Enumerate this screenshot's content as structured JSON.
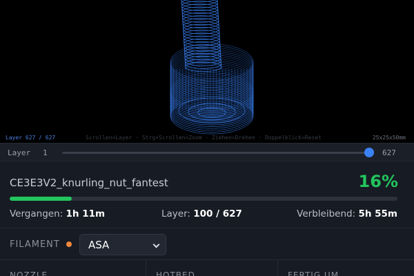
{
  "viewer": {
    "layer_readout": "Layer 627 / 627",
    "controls_hint": "Scrollen=Layer · Strg+Scrollen=Zoom · Ziehen=Drehen · Doppelklick=Reset",
    "dimensions": "25x25x50mm",
    "model_color": "#3b82f6"
  },
  "slider": {
    "label": "Layer",
    "min": "1",
    "max": "627",
    "value": 627,
    "accent": "#3b82f6"
  },
  "job": {
    "filename": "CE3E3V2_knurling_nut_fantest",
    "percent_label": "16%",
    "progress": 0.16,
    "accent": "#22c55e",
    "elapsed_label": "Vergangen:",
    "elapsed_value": "1h 11m",
    "layer_label": "Layer:",
    "layer_value": "100 / 627",
    "remaining_label": "Verbleibend:",
    "remaining_value": "5h 55m"
  },
  "filament": {
    "label": "FILAMENT",
    "dot_color": "#f0883e",
    "selected": "ASA",
    "icon": "chevron-down-icon"
  },
  "cards": [
    {
      "title": "NOZZLE"
    },
    {
      "title": "HOTBED"
    },
    {
      "title": "FERTIG UM"
    }
  ]
}
